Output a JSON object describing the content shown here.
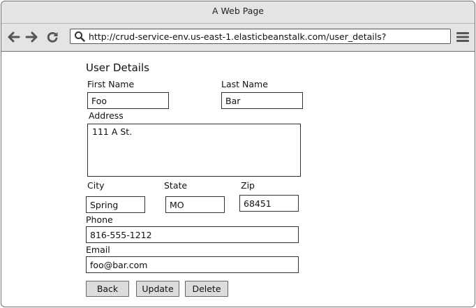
{
  "window": {
    "title": "A Web Page"
  },
  "toolbar": {
    "url": "http://crud-service-env.us-east-1.elasticbeanstalk.com/user_details?",
    "icons": [
      "back-arrow-icon",
      "forward-arrow-icon",
      "reload-icon",
      "search-icon",
      "hamburger-menu-icon"
    ]
  },
  "form": {
    "heading": "User Details",
    "first_name": {
      "label": "First Name",
      "value": "Foo"
    },
    "last_name": {
      "label": "Last Name",
      "value": "Bar"
    },
    "address": {
      "label": "Address",
      "value": "111 A St."
    },
    "city": {
      "label": "City",
      "value": "Spring"
    },
    "state": {
      "label": "State",
      "value": "MO"
    },
    "zip": {
      "label": "Zip",
      "value": "68451"
    },
    "phone": {
      "label": "Phone",
      "value": "816-555-1212"
    },
    "email": {
      "label": "Email",
      "value": "foo@bar.com"
    }
  },
  "buttons": {
    "back": "Back",
    "update": "Update",
    "delete": "Delete"
  },
  "colors": {
    "chrome": "#e4e4e4",
    "border": "#6f6f6f",
    "button": "#dcdcdc"
  }
}
